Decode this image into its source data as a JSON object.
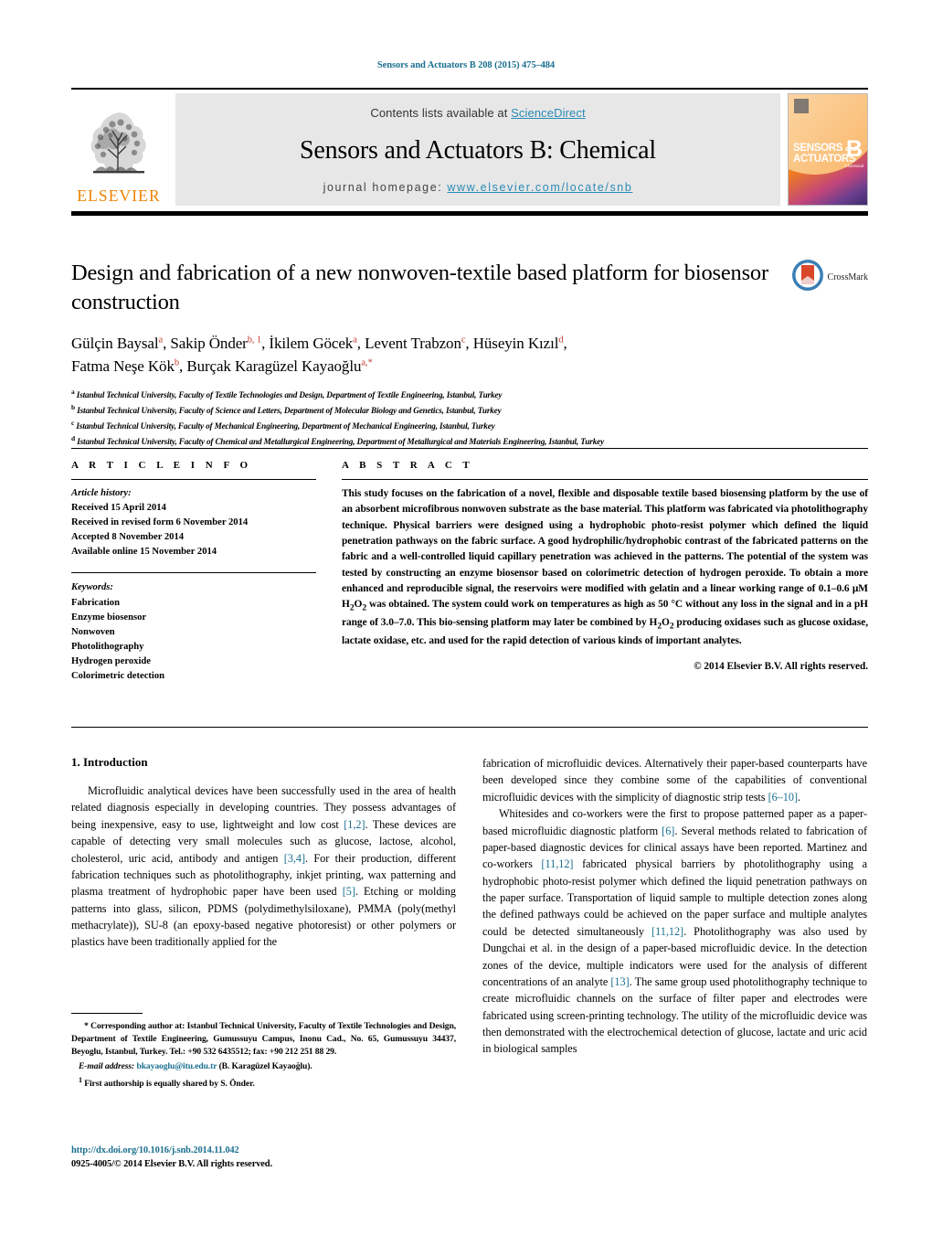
{
  "running_head": "Sensors and Actuators B 208 (2015) 475–484",
  "masthead": {
    "contents_prefix": "Contents lists available at ",
    "contents_link": "ScienceDirect",
    "journal_title": "Sensors and Actuators B: Chemical",
    "homepage_prefix": "journal homepage: ",
    "homepage_url": "www.elsevier.com/locate/snb",
    "publisher": "ELSEVIER",
    "cover": {
      "line1": "SENSORS",
      "line1_small": "and",
      "line2": "ACTUATORS",
      "volume_letter": "B",
      "volume_sub": "Chemical"
    }
  },
  "article": {
    "title": "Design and fabrication of a new nonwoven-textile based platform for biosensor construction",
    "crossmark_label": "CrossMark",
    "authors_line1": "Gülçin Baysal",
    "authors": [
      {
        "name": "Gülçin Baysal",
        "sup": "a"
      },
      {
        "name": "Sakip Önder",
        "sup": "b, 1"
      },
      {
        "name": "İkilem Göcek",
        "sup": "a"
      },
      {
        "name": "Levent Trabzon",
        "sup": "c"
      },
      {
        "name": "Hüseyin Kızıl",
        "sup": "d"
      },
      {
        "name": "Fatma Neşe Kök",
        "sup": "b"
      },
      {
        "name": "Burçak Karagüzel Kayaoğlu",
        "sup": "a,*"
      }
    ],
    "affiliations": [
      {
        "mark": "a",
        "text": "Istanbul Technical University, Faculty of Textile Technologies and Design, Department of Textile Engineering, Istanbul, Turkey"
      },
      {
        "mark": "b",
        "text": "Istanbul Technical University, Faculty of Science and Letters, Department of Molecular Biology and Genetics, Istanbul, Turkey"
      },
      {
        "mark": "c",
        "text": "Istanbul Technical University, Faculty of Mechanical Engineering, Department of Mechanical Engineering, Istanbul, Turkey"
      },
      {
        "mark": "d",
        "text": "Istanbul Technical University, Faculty of Chemical and Metallurgical Engineering, Department of Metallurgical and Materials Engineering, Istanbul, Turkey"
      }
    ]
  },
  "article_info": {
    "heading": "A R T I C L E    I N F O",
    "history_label": "Article history:",
    "history": [
      "Received 15 April 2014",
      "Received in revised form 6 November 2014",
      "Accepted 8 November 2014",
      "Available online 15 November 2014"
    ],
    "keywords_label": "Keywords:",
    "keywords": [
      "Fabrication",
      "Enzyme biosensor",
      "Nonwoven",
      "Photolithography",
      "Hydrogen peroxide",
      "Colorimetric detection"
    ]
  },
  "abstract": {
    "heading": "A B S T R A C T",
    "text": "This study focuses on the fabrication of a novel, flexible and disposable textile based biosensing platform by the use of an absorbent microfibrous nonwoven substrate as the base material. This platform was fabricated via photolithography technique. Physical barriers were designed using a hydrophobic photo-resist polymer which defined the liquid penetration pathways on the fabric surface. A good hydrophilic/hydrophobic contrast of the fabricated patterns on the fabric and a well-controlled liquid capillary penetration was achieved in the patterns. The potential of the system was tested by constructing an enzyme biosensor based on colorimetric detection of hydrogen peroxide. To obtain a more enhanced and reproducible signal, the reservoirs were modified with gelatin and a linear working range of 0.1–0.6 μM H2O2 was obtained. The system could work on temperatures as high as 50 °C without any loss in the signal and in a pH range of 3.0–7.0. This bio-sensing platform may later be combined by H2O2 producing oxidases such as glucose oxidase, lactate oxidase, etc. and used for the rapid detection of various kinds of important analytes.",
    "copyright": "© 2014 Elsevier B.V. All rights reserved."
  },
  "body": {
    "section_heading": "1.  Introduction",
    "left_paragraph_1": "Microfluidic analytical devices have been successfully used in the area of health related diagnosis especially in developing countries. They possess advantages of being inexpensive, easy to use, lightweight and low cost [1,2]. These devices are capable of detecting very small molecules such as glucose, lactose, alcohol, cholesterol, uric acid, antibody and antigen [3,4]. For their production, different fabrication techniques such as photolithography, inkjet printing, wax patterning and plasma treatment of hydrophobic paper have been used [5]. Etching or molding patterns into glass, silicon, PDMS (polydimethylsiloxane), PMMA (poly(methyl methacrylate)), SU-8 (an epoxy-based negative photoresist) or other polymers or plastics have been traditionally applied for the",
    "right_paragraph_1": "fabrication of microfluidic devices. Alternatively their paper-based counterparts have been developed since they combine some of the capabilities of conventional microfluidic devices with the simplicity of diagnostic strip tests [6–10].",
    "right_paragraph_2": "Whitesides and co-workers were the first to propose patterned paper as a paper-based microfluidic diagnostic platform [6]. Several methods related to fabrication of paper-based diagnostic devices for clinical assays have been reported. Martinez and co-workers [11,12] fabricated physical barriers by photolithography using a hydrophobic photo-resist polymer which defined the liquid penetration pathways on the paper surface. Transportation of liquid sample to multiple detection zones along the defined pathways could be achieved on the paper surface and multiple analytes could be detected simultaneously [11,12]. Photolithography was also used by Dungchai et al. in the design of a paper-based microfluidic device. In the detection zones of the device, multiple indicators were used for the analysis of different concentrations of an analyte [13]. The same group used photolithography technique to create microfluidic channels on the surface of filter paper and electrodes were fabricated using screen-printing technology. The utility of the microfluidic device was then demonstrated with the electrochemical detection of glucose, lactate and uric acid in biological samples"
  },
  "footnotes": {
    "corresponding": "* Corresponding author at: Istanbul Technical University, Faculty of Textile Technologies and Design, Department of Textile Engineering, Gumussuyu Campus, Inonu Cad., No. 65, Gumussuyu 34437, Beyoglu, Istanbul, Turkey. Tel.: +90 532 6435512; fax: +90 212 251 88 29.",
    "email_label": "E-mail address:",
    "email": "bkayaoglu@itu.edu.tr",
    "email_owner": "(B. Karagüzel Kayaoğlu).",
    "first_authorship_mark": "1",
    "first_authorship": "First authorship is equally shared by S. Önder."
  },
  "doi": {
    "url": "http://dx.doi.org/10.1016/j.snb.2014.11.042",
    "issn_line": "0925-4005/© 2014 Elsevier B.V. All rights reserved."
  },
  "colors": {
    "link": "#1a6f8f",
    "science_direct": "#2b8bb5",
    "elsevier_orange": "#ef8200",
    "reference": "#1a6f8f",
    "masthead_bg": "#e7e7e7"
  }
}
